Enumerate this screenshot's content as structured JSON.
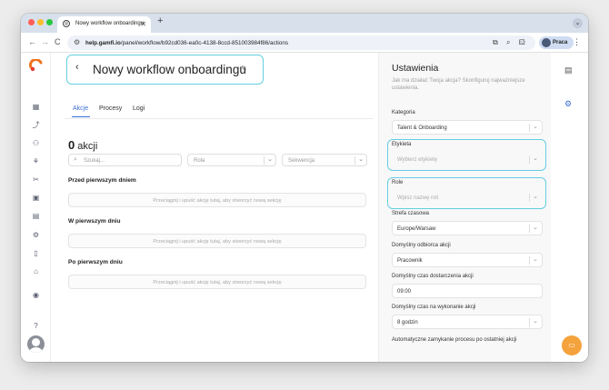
{
  "browser": {
    "tab_title": "Nowy workflow onboardingu",
    "url_host": "help.gamfi.io",
    "url_path": "/panel/workflow/b92cd036-ea0c-4138-8ccd-851003984f86/actions",
    "profile_label": "Praca"
  },
  "page": {
    "title": "Nowy workflow onboardingu",
    "tabs": [
      "Akcje",
      "Procesy",
      "Logi"
    ],
    "active_tab": "Akcje",
    "count_value": "0",
    "count_label": "akcji",
    "search_placeholder": "Szukaj...",
    "role_placeholder": "Rola",
    "sequence_placeholder": "Sekwencja",
    "sections": [
      {
        "title": "Przed pierwszym dniem",
        "dropzone": "Przeciągnij i upuść akcję tutaj, aby stworzyć nową sekcję"
      },
      {
        "title": "W pierwszym dniu",
        "dropzone": "Przeciągnij i upuść akcję tutaj, aby stworzyć nową sekcję"
      },
      {
        "title": "Po pierwszym dniu",
        "dropzone": "Przeciągnij i upuść akcję tutaj, aby stworzyć nową sekcję"
      }
    ]
  },
  "settings": {
    "title": "Ustawienia",
    "subtitle": "Jak ma działać Twoja akcja? Skonfiguruj najważniejsze ustawienia.",
    "category_label": "Kategoria",
    "category_value": "Talent & Onboarding",
    "tag_label": "Etykieta",
    "tag_placeholder": "Wybierz etykietę",
    "role_label": "Role",
    "role_placeholder": "Wpisz nazwę roli",
    "timezone_label": "Strefa czasowa",
    "timezone_value": "Europe/Warsaw",
    "recipient_label": "Domyślny odbiorca akcji",
    "recipient_value": "Pracownik",
    "delivery_label": "Domyślny czas dostarczenia akcji",
    "delivery_value": "09:00",
    "exec_label": "Domyślny czas na wykonanie akcji",
    "exec_value": "8 godzin",
    "autoclose_label": "Automatyczne zamykanie procesu po ostatniej akcji"
  },
  "colors": {
    "accent": "#3b6fd8",
    "highlight": "#63cfe0",
    "fab": "#f4a23c",
    "logo": "#f0731e"
  }
}
